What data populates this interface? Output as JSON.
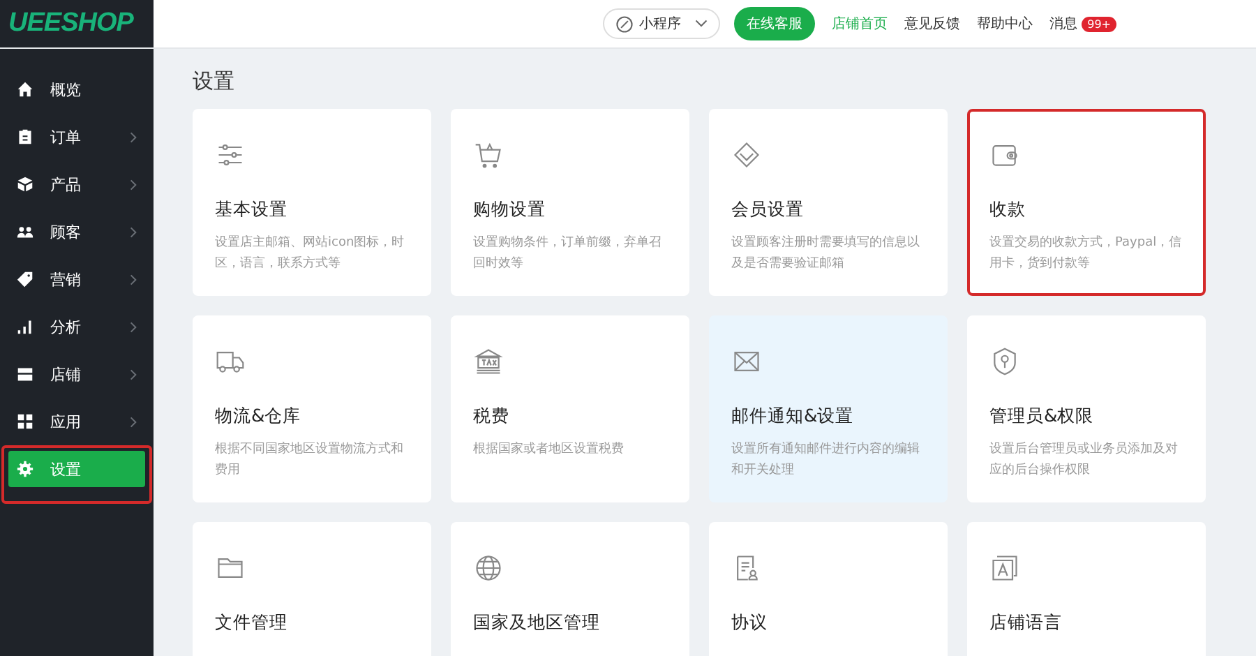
{
  "logo": "UEESHOP",
  "topbar": {
    "miniapp": "小程序",
    "service_button": "在线客服",
    "links": [
      {
        "label": "店铺首页",
        "kind": "accent"
      },
      {
        "label": "意见反馈",
        "kind": "plain"
      },
      {
        "label": "帮助中心",
        "kind": "plain"
      },
      {
        "label": "消息",
        "kind": "plain",
        "badge": "99+"
      }
    ]
  },
  "sidebar": {
    "items": [
      {
        "label": "概览",
        "arrow": false,
        "selected": false,
        "highlighted": false
      },
      {
        "label": "订单",
        "arrow": true,
        "selected": false,
        "highlighted": false
      },
      {
        "label": "产品",
        "arrow": true,
        "selected": false,
        "highlighted": false
      },
      {
        "label": "顾客",
        "arrow": true,
        "selected": false,
        "highlighted": false
      },
      {
        "label": "营销",
        "arrow": true,
        "selected": false,
        "highlighted": false
      },
      {
        "label": "分析",
        "arrow": true,
        "selected": false,
        "highlighted": false
      },
      {
        "label": "店铺",
        "arrow": true,
        "selected": false,
        "highlighted": false
      },
      {
        "label": "应用",
        "arrow": true,
        "selected": false,
        "highlighted": false
      },
      {
        "label": "设置",
        "arrow": false,
        "selected": true,
        "highlighted": true
      }
    ]
  },
  "page_title": "设置",
  "cards": [
    {
      "title": "基本设置",
      "description": "设置店主邮箱、网站icon图标，时区，语言，联系方式等",
      "hovered": false,
      "highlighted": false
    },
    {
      "title": "购物设置",
      "description": "设置购物条件，订单前缀，弃单召回时效等",
      "hovered": false,
      "highlighted": false
    },
    {
      "title": "会员设置",
      "description": "设置顾客注册时需要填写的信息以及是否需要验证邮箱",
      "hovered": false,
      "highlighted": false
    },
    {
      "title": "收款",
      "description": "设置交易的收款方式，Paypal，信用卡，货到付款等",
      "hovered": false,
      "highlighted": true
    },
    {
      "title": "物流&仓库",
      "description": "根据不同国家地区设置物流方式和费用",
      "hovered": false,
      "highlighted": false
    },
    {
      "title": "税费",
      "description": "根据国家或者地区设置税费",
      "hovered": false,
      "highlighted": false
    },
    {
      "title": "邮件通知&设置",
      "description": "设置所有通知邮件进行内容的编辑和开关处理",
      "hovered": true,
      "highlighted": false
    },
    {
      "title": "管理员&权限",
      "description": "设置后台管理员或业务员添加及对应的后台操作权限",
      "hovered": false,
      "highlighted": false
    },
    {
      "title": "文件管理",
      "hovered": false,
      "highlighted": false
    },
    {
      "title": "国家及地区管理",
      "hovered": false,
      "highlighted": false
    },
    {
      "title": "协议",
      "hovered": false,
      "highlighted": false
    },
    {
      "title": "店铺语言",
      "hovered": false,
      "highlighted": false
    }
  ]
}
